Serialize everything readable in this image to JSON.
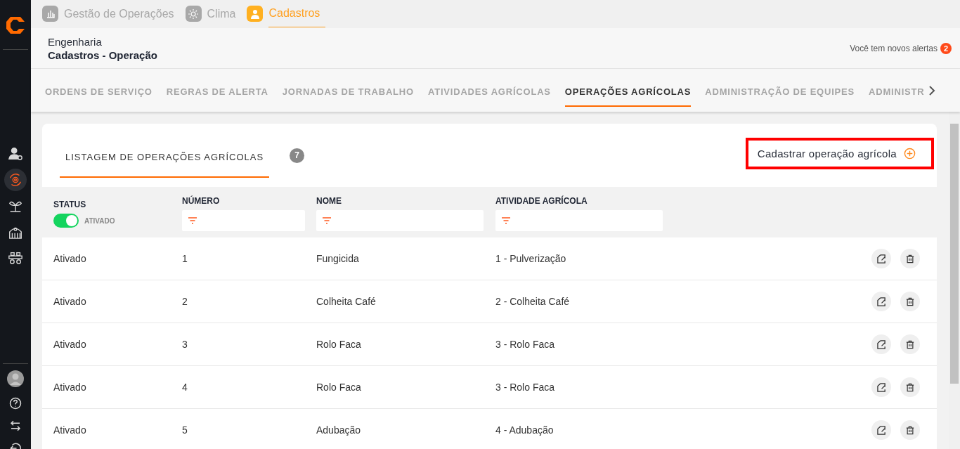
{
  "app_tabs": [
    {
      "label": "Gestão de Operações",
      "selected": false
    },
    {
      "label": "Clima",
      "selected": false
    },
    {
      "label": "Cadastros",
      "selected": true
    }
  ],
  "sidebar": {
    "items": [
      {
        "selected": false
      },
      {
        "selected": true
      },
      {
        "selected": false
      },
      {
        "selected": false
      },
      {
        "selected": false
      }
    ]
  },
  "header": {
    "section": "Engenharia",
    "title": "Cadastros - Operação",
    "alerts_text": "Você tem novos alertas",
    "alerts_count": "2"
  },
  "sub_tabs": [
    {
      "label": "ORDENS DE SERVIÇO",
      "selected": false
    },
    {
      "label": "REGRAS DE ALERTA",
      "selected": false
    },
    {
      "label": "JORNADAS DE TRABALHO",
      "selected": false
    },
    {
      "label": "ATIVIDADES AGRÍCOLAS",
      "selected": false
    },
    {
      "label": "OPERAÇÕES AGRÍCOLAS",
      "selected": true
    },
    {
      "label": "ADMINISTRAÇÃO DE EQUIPES",
      "selected": false
    },
    {
      "label": "ADMINISTR",
      "selected": false
    }
  ],
  "listing": {
    "tab": "LISTAGEM DE OPERAÇÕES AGRÍCOLAS",
    "count": "7",
    "add_button": {
      "label": "Cadastrar operação agrícola",
      "highlighted": true
    }
  },
  "table": {
    "columns": [
      "STATUS",
      "NÚMERO",
      "NOME",
      "ATIVIDADE AGRÍCOLA"
    ],
    "status_toggle": {
      "label": "ATIVADO",
      "on": true
    },
    "rows": [
      {
        "status": "Ativado",
        "number": "1",
        "name": "Fungicida",
        "activity": "1 - Pulverização"
      },
      {
        "status": "Ativado",
        "number": "2",
        "name": "Colheita Café",
        "activity": "2 - Colheita Café"
      },
      {
        "status": "Ativado",
        "number": "3",
        "name": "Rolo Faca",
        "activity": "3 - Rolo Faca"
      },
      {
        "status": "Ativado",
        "number": "4",
        "name": "Rolo Faca",
        "activity": "3 - Rolo Faca"
      },
      {
        "status": "Ativado",
        "number": "5",
        "name": "Adubação",
        "activity": "4 - Adubação"
      }
    ]
  }
}
